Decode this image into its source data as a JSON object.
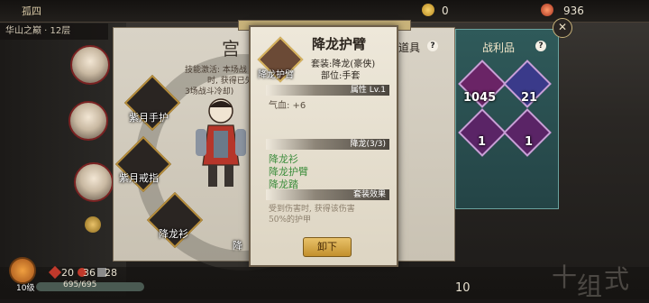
{
  "topbar": {
    "name": "孤四",
    "resource_1": "0",
    "resource_2": "936"
  },
  "location": "华山之巅 · 12层",
  "palace": {
    "title": "宫",
    "skill_lines": [
      "技能激活: 本场战",
      "时, 获得已失",
      "3场战斗冷却)"
    ]
  },
  "slots": [
    {
      "label": "紫月手护"
    },
    {
      "label": "紫月戒指"
    },
    {
      "label": "降龙衫"
    },
    {
      "label": "降"
    }
  ],
  "items_header": {
    "label": "道具"
  },
  "loot": {
    "title": "战利品",
    "items": [
      {
        "count": "1045",
        "icon": "red-coin-icon"
      },
      {
        "count": "21",
        "icon": "gem-icon"
      },
      {
        "count": "1",
        "icon": "pink-orb-icon"
      },
      {
        "count": "1",
        "icon": "bag-icon"
      }
    ]
  },
  "popup": {
    "title": "降龙护臂",
    "icon_label": "降龙护臂",
    "set_line": "套装:降龙(豪侠)",
    "part_line": "部位:手套",
    "attr_header": "属性 Lv.1",
    "stat": "气血: +6",
    "set_header": "降龙(3/3)",
    "set_items": [
      "降龙衫",
      "降龙护臂",
      "降龙踏"
    ],
    "effect_header": "套装效果",
    "effect_lines": [
      "受到伤害时, 获得该伤害",
      "50%的护甲"
    ],
    "unequip_label": "卸下"
  },
  "bottom": {
    "level": "10级",
    "stat_1": "20",
    "stat_2": "36",
    "stat_3": "28",
    "hp": "695/695",
    "num_right": "10",
    "big_chars": [
      "十",
      "组",
      "式"
    ]
  },
  "colors": {
    "accent_gold": "#c9b37a",
    "set_green": "#3c8d3c",
    "loot_teal": "#2f5a5a"
  }
}
